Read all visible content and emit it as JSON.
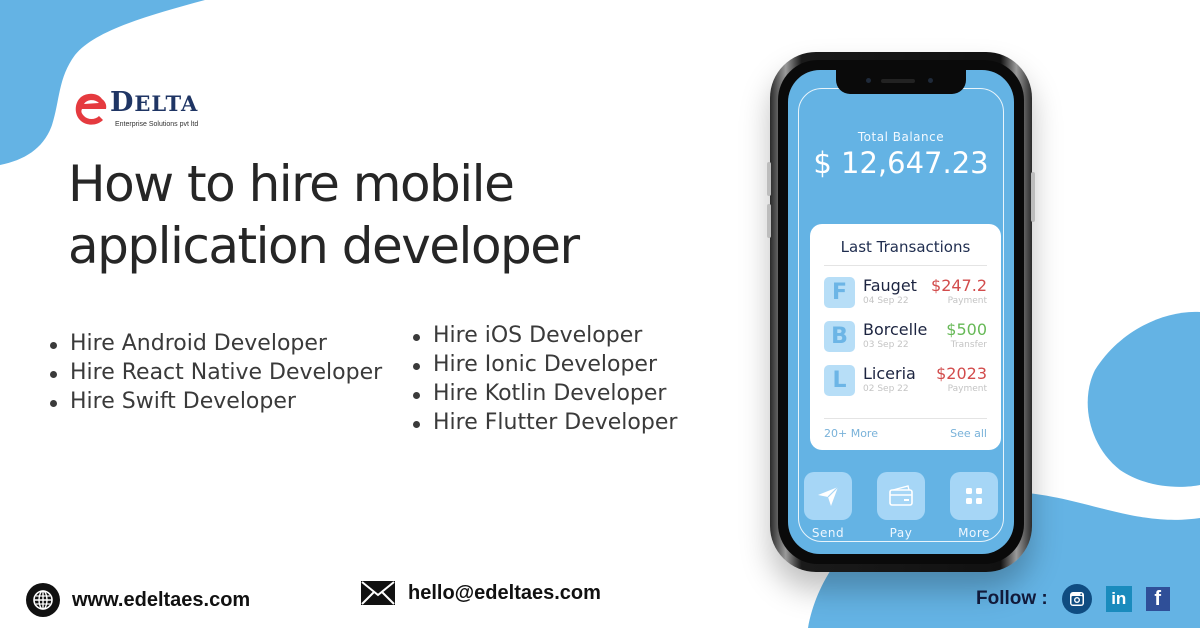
{
  "colors": {
    "accent_blue": "#64b3e4",
    "brand_navy": "#1f3564",
    "brand_red": "#e53a3f",
    "amount_negative": "#d24c4c",
    "amount_positive": "#67b957"
  },
  "brand": {
    "logo_initial": "e",
    "logo_word_big": "D",
    "logo_word_rest": "ELTA",
    "tagline": "Enterprise Solutions pvt ltd"
  },
  "headline": {
    "line1": "How to hire mobile",
    "line2": "application developer"
  },
  "services": {
    "left": [
      "Hire Android Developer",
      "Hire React Native Developer",
      "Hire Swift Developer"
    ],
    "right": [
      "Hire iOS Developer",
      "Hire Ionic Developer",
      "Hire Kotlin Developer",
      "Hire Flutter Developer"
    ]
  },
  "phone_app": {
    "balance_label": "Total Balance",
    "balance_value": "$ 12,647.23",
    "transactions_title": "Last Transactions",
    "transactions": [
      {
        "initial": "F",
        "name": "Fauget",
        "date": "04 Sep 22",
        "amount": "$247.2",
        "type": "Payment",
        "direction": "negative"
      },
      {
        "initial": "B",
        "name": "Borcelle",
        "date": "03 Sep 22",
        "amount": "$500",
        "type": "Transfer",
        "direction": "positive"
      },
      {
        "initial": "L",
        "name": "Liceria",
        "date": "02 Sep 22",
        "amount": "$2023",
        "type": "Payment",
        "direction": "negative"
      }
    ],
    "more_link": "20+ More",
    "see_all_link": "See all",
    "actions": [
      {
        "label": "Send",
        "icon": "send-icon"
      },
      {
        "label": "Pay",
        "icon": "card-icon"
      },
      {
        "label": "More",
        "icon": "grid-icon"
      }
    ]
  },
  "footer": {
    "website": "www.edeltaes.com",
    "email": "hello@edeltaes.com",
    "follow_label": "Follow :",
    "socials": [
      {
        "name": "instagram",
        "icon": "instagram-icon"
      },
      {
        "name": "linkedin",
        "icon": "linkedin-icon",
        "glyph": "in"
      },
      {
        "name": "facebook",
        "icon": "facebook-icon",
        "glyph": "f"
      }
    ]
  }
}
